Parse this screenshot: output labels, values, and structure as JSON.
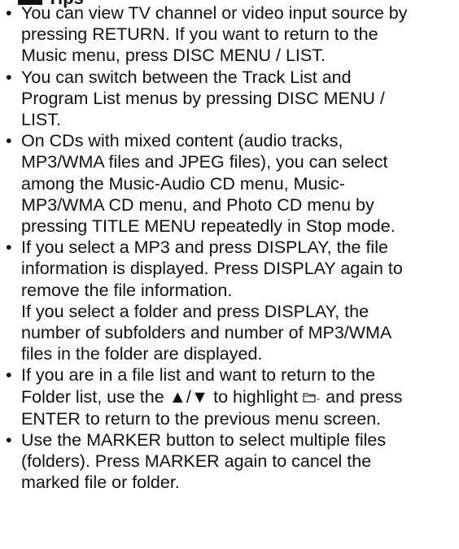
{
  "heading": "Tips",
  "tips": [
    {
      "paragraphs": [
        {
          "lines": [
            "You can view TV channel or video input source by",
            "pressing RETURN. If you want to return to the",
            "Music menu, press DISC MENU / LIST."
          ]
        }
      ]
    },
    {
      "paragraphs": [
        {
          "lines": [
            "You can switch between the Track List and",
            "Program List menus by pressing DISC MENU /",
            "LIST."
          ]
        }
      ]
    },
    {
      "paragraphs": [
        {
          "lines": [
            "On CDs with mixed content (audio tracks,",
            "MP3/WMA files and JPEG files), you can select",
            "among the Music-Audio CD menu, Music-",
            "MP3/WMA CD menu, and Photo CD menu by",
            "pressing TITLE MENU repeatedly in Stop mode."
          ]
        }
      ]
    },
    {
      "paragraphs": [
        {
          "lines": [
            "If you select a MP3 and press DISPLAY, the file",
            "information is displayed. Press DISPLAY again to",
            "remove the file information."
          ]
        },
        {
          "lines": [
            "If you select a folder and press DISPLAY, the",
            "number of subfolders and number of MP3/WMA",
            "files in the folder are displayed."
          ]
        }
      ]
    },
    {
      "paragraphs": [
        {
          "lines": [
            "If you are in a file list and want to return to the",
            "Folder list, use the ▲/▼ to highlight",
            "ENTER to return to the previous menu screen."
          ],
          "icon_after_line": 1,
          "icon_name": "folder-up-icon",
          "icon_trailing_text": "and press"
        }
      ]
    },
    {
      "paragraphs": [
        {
          "lines": [
            "Use the MARKER button to select multiple files",
            "(folders). Press MARKER again to cancel the",
            "marked file or folder."
          ]
        }
      ]
    }
  ],
  "bullet_char": "•"
}
